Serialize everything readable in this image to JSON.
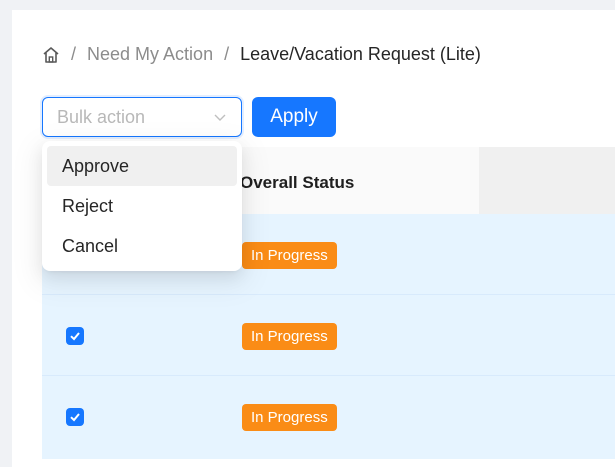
{
  "breadcrumb": {
    "items": [
      "Need My Action",
      "Leave/Vacation Request (Lite)"
    ],
    "separator": "/"
  },
  "bulk_action": {
    "placeholder": "Bulk action",
    "options": [
      "Approve",
      "Reject",
      "Cancel"
    ],
    "highlighted_option": "Approve"
  },
  "apply_label": "Apply",
  "table": {
    "columns": [
      "Overall Status"
    ],
    "rows": [
      {
        "checked": null,
        "status": "In Progress"
      },
      {
        "checked": true,
        "status": "In Progress"
      },
      {
        "checked": true,
        "status": "In Progress"
      }
    ]
  },
  "colors": {
    "primary": "#1677ff",
    "status_in_progress": "#fa8c16",
    "selected_row": "#e6f4ff"
  }
}
